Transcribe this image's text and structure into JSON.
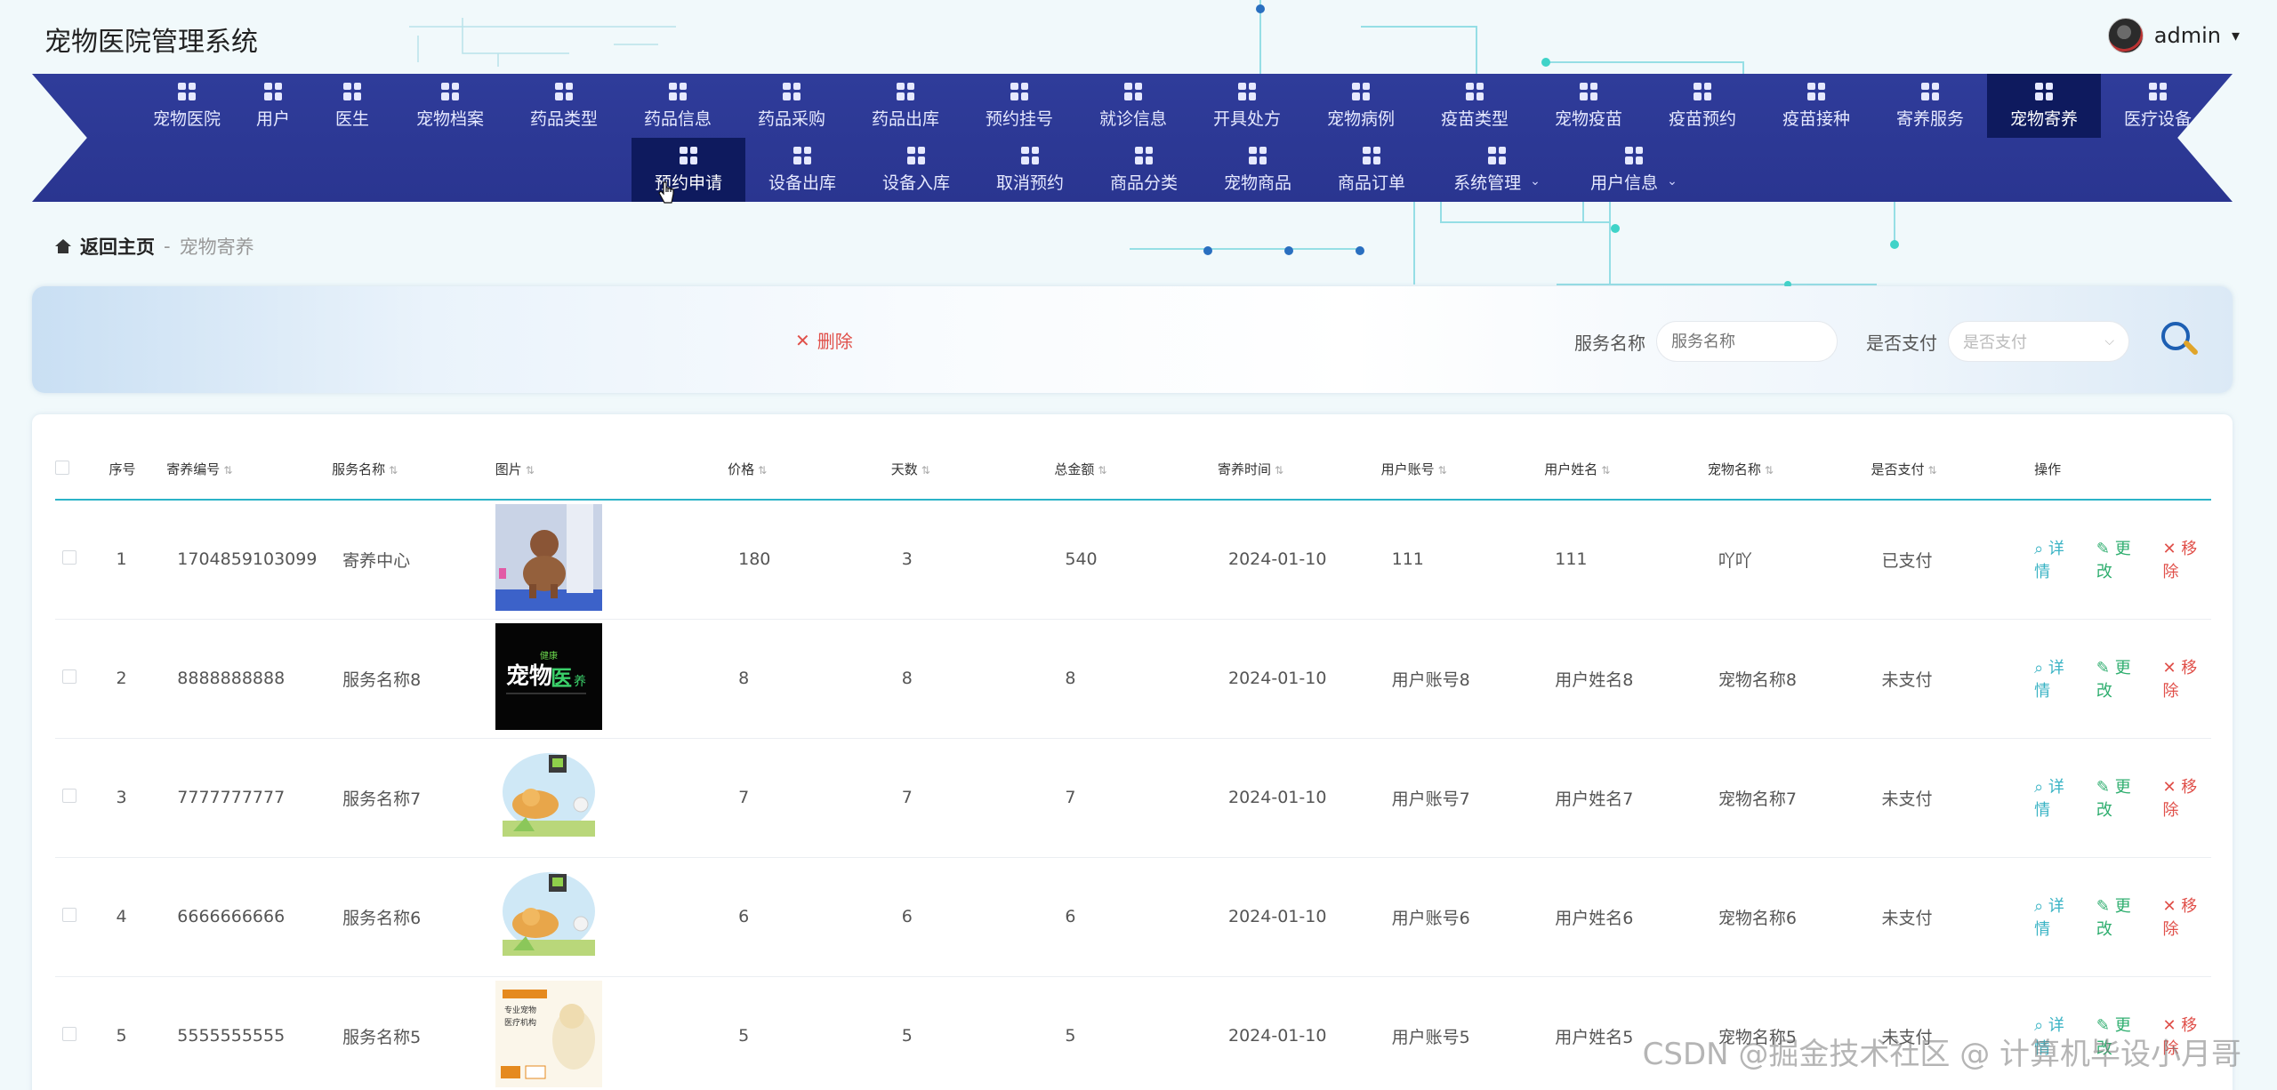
{
  "app": {
    "title": "宠物医院管理系统"
  },
  "user": {
    "name": "admin"
  },
  "nav": {
    "row1": [
      {
        "label": "宠物医院"
      },
      {
        "label": "用户"
      },
      {
        "label": "医生"
      },
      {
        "label": "宠物档案"
      },
      {
        "label": "药品类型"
      },
      {
        "label": "药品信息"
      },
      {
        "label": "药品采购"
      },
      {
        "label": "药品出库"
      },
      {
        "label": "预约挂号"
      },
      {
        "label": "就诊信息"
      },
      {
        "label": "开具处方"
      },
      {
        "label": "宠物病例"
      },
      {
        "label": "疫苗类型"
      },
      {
        "label": "宠物疫苗"
      },
      {
        "label": "疫苗预约"
      },
      {
        "label": "疫苗接种"
      },
      {
        "label": "寄养服务"
      },
      {
        "label": "宠物寄养"
      },
      {
        "label": "医疗设备"
      }
    ],
    "row2": [
      {
        "label": "预约申请"
      },
      {
        "label": "设备出库"
      },
      {
        "label": "设备入库"
      },
      {
        "label": "取消预约"
      },
      {
        "label": "商品分类"
      },
      {
        "label": "宠物商品"
      },
      {
        "label": "商品订单"
      },
      {
        "label": "系统管理"
      },
      {
        "label": "用户信息"
      }
    ]
  },
  "breadcrumb": {
    "home": "返回主页",
    "sep": "-",
    "current": "宠物寄养"
  },
  "toolbar": {
    "delete_label": "删除"
  },
  "search": {
    "service_label": "服务名称",
    "service_placeholder": "服务名称",
    "paid_label": "是否支付",
    "paid_placeholder": "是否支付"
  },
  "table": {
    "headers": [
      "序号",
      "寄养编号",
      "服务名称",
      "图片",
      "价格",
      "天数",
      "总金额",
      "寄养时间",
      "用户账号",
      "用户姓名",
      "宠物名称",
      "是否支付",
      "操作"
    ],
    "ops": {
      "detail": "详情",
      "edit": "更改",
      "remove": "移除"
    },
    "rows": [
      {
        "idx": "1",
        "code": "1704859103099",
        "service": "寄养中心",
        "price": "180",
        "days": "3",
        "total": "540",
        "date": "2024-01-10",
        "account": "111",
        "username": "111",
        "pet": "吖吖",
        "paid": "已支付"
      },
      {
        "idx": "2",
        "code": "8888888888",
        "service": "服务名称8",
        "price": "8",
        "days": "8",
        "total": "8",
        "date": "2024-01-10",
        "account": "用户账号8",
        "username": "用户姓名8",
        "pet": "宠物名称8",
        "paid": "未支付"
      },
      {
        "idx": "3",
        "code": "7777777777",
        "service": "服务名称7",
        "price": "7",
        "days": "7",
        "total": "7",
        "date": "2024-01-10",
        "account": "用户账号7",
        "username": "用户姓名7",
        "pet": "宠物名称7",
        "paid": "未支付"
      },
      {
        "idx": "4",
        "code": "6666666666",
        "service": "服务名称6",
        "price": "6",
        "days": "6",
        "total": "6",
        "date": "2024-01-10",
        "account": "用户账号6",
        "username": "用户姓名6",
        "pet": "宠物名称6",
        "paid": "未支付"
      },
      {
        "idx": "5",
        "code": "5555555555",
        "service": "服务名称5",
        "price": "5",
        "days": "5",
        "total": "5",
        "date": "2024-01-10",
        "account": "用户账号5",
        "username": "用户姓名5",
        "pet": "宠物名称5",
        "paid": "未支付"
      }
    ]
  },
  "watermark": "CSDN @掘金技术社区 @ 计算机毕设小月哥",
  "colors": {
    "nav": "#2f3c9a",
    "nav_active": "#0e1a5e",
    "accent": "#2bb3c8",
    "danger": "#e0504a",
    "success": "#2fae6f"
  }
}
